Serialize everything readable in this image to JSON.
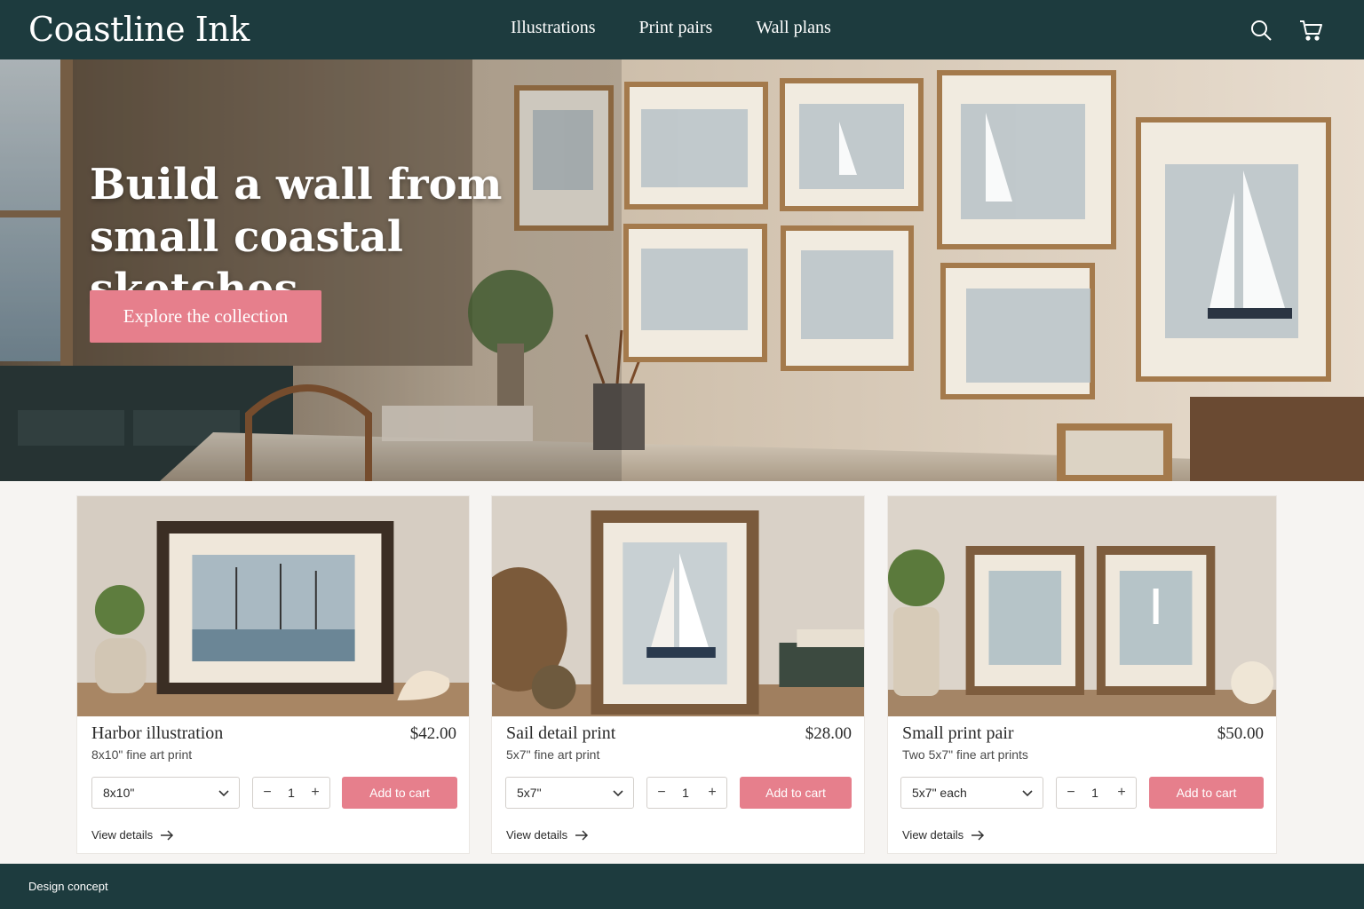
{
  "header": {
    "brand": "Coastline Ink",
    "nav": [
      "Illustrations",
      "Print pairs",
      "Wall plans"
    ],
    "icons": [
      "search-icon",
      "cart-icon"
    ]
  },
  "hero": {
    "title_line1": "Build a wall from",
    "title_line2": "small coastal sketches",
    "cta": "Explore the collection"
  },
  "products": [
    {
      "name": "Harbor illustration",
      "price": "$42.00",
      "description": "8x10\" fine art print",
      "size": "8x10\"",
      "quantity": "1",
      "add_label": "Add to cart",
      "details_label": "View details"
    },
    {
      "name": "Sail detail print",
      "price": "$28.00",
      "description": "5x7\" fine art print",
      "size": "5x7\"",
      "quantity": "1",
      "add_label": "Add to cart",
      "details_label": "View details"
    },
    {
      "name": "Small print pair",
      "price": "$50.00",
      "description": "Two 5x7\" fine art prints",
      "size": "5x7\" each",
      "quantity": "1",
      "add_label": "Add to cart",
      "details_label": "View details"
    }
  ],
  "stepper": {
    "minus": "−",
    "plus": "+"
  },
  "footer": {
    "text": "Design concept"
  },
  "colors": {
    "header_bg": "#1d3b3e",
    "accent": "#e67f8c",
    "page_bg": "#f6f4f2"
  }
}
